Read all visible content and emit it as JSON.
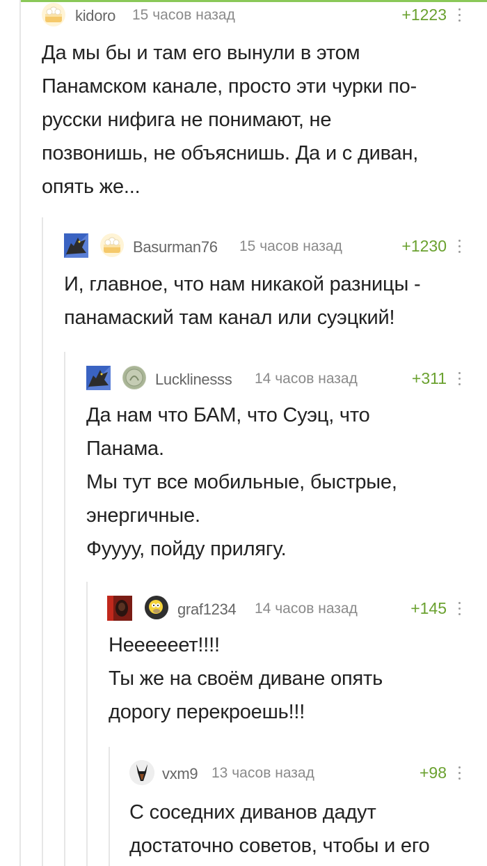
{
  "comments": [
    {
      "username": "kidoro",
      "time": "15 часов назад",
      "rating": "+1223",
      "text": "Да мы бы и там его вынули в этом\nПанамском канале, просто эти чурки по-\nрусски нифига не понимают, не\nпозвонишь, не объяснишь. Да и с диван,\nопять же..."
    },
    {
      "username": "Basurman76",
      "time": "15 часов назад",
      "rating": "+1230",
      "text": "И, главное, что нам никакой разницы -\nпанамаский там канал или суэцкий!"
    },
    {
      "username": "Lucklinesss",
      "time": "14 часов назад",
      "rating": "+311",
      "text": "Да нам что БАМ, что Суэц, что\nПанама.\nМы тут все мобильные, быстрые,\nэнергичные.\nФуууу, пойду прилягу."
    },
    {
      "username": "graf1234",
      "time": "14 часов назад",
      "rating": "+145",
      "text": "Неееееет!!!!\nТы же на своём диване опять\nдорогу перекроешь!!!"
    },
    {
      "username": "vxm9",
      "time": "13 часов назад",
      "rating": "+98",
      "text": "С соседних диванов дадут\nдостаточно советов, чтобы и его"
    }
  ],
  "colors": {
    "rating": "#6aa12f",
    "accent": "#8ac858",
    "thread_line": "#e6e6e6",
    "meta_text": "#8a8a8a"
  },
  "icons": [
    "cake-avatar-icon",
    "ukraine-flag-icon",
    "coin-avatar-icon",
    "dragon-avatar-icon",
    "more-vertical-icon"
  ]
}
